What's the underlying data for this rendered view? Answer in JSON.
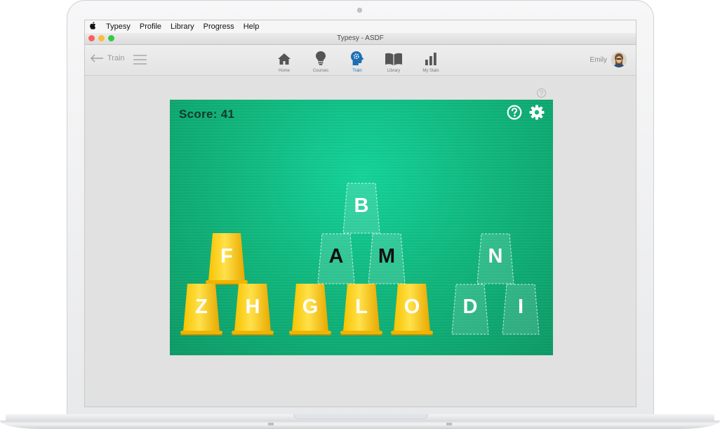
{
  "menubar": {
    "apple_icon": "apple-icon",
    "items": [
      "Typesy",
      "Profile",
      "Library",
      "Progress",
      "Help"
    ]
  },
  "window": {
    "title": "Typesy - ASDF",
    "traffic_lights": [
      "#fc605c",
      "#fdbc40",
      "#34c84a"
    ]
  },
  "toolbar": {
    "back_label": "Train",
    "nav": [
      {
        "label": "Home",
        "icon": "home-icon",
        "active": false
      },
      {
        "label": "Courses",
        "icon": "lightbulb-icon",
        "active": false
      },
      {
        "label": "Train",
        "icon": "brain-head-icon",
        "active": true
      },
      {
        "label": "Library",
        "icon": "book-icon",
        "active": false
      },
      {
        "label": "My Stats",
        "icon": "bar-chart-icon",
        "active": false
      }
    ],
    "user_name": "Emily",
    "active_color": "#1c6fb4"
  },
  "game": {
    "score_label": "Score:",
    "score_value": "41",
    "background": "#10b87e",
    "cup_color": "#f6b800",
    "cups": [
      {
        "letter": "F",
        "state": "stacked"
      },
      {
        "letter": "Z",
        "state": "stacked"
      },
      {
        "letter": "H",
        "state": "stacked"
      },
      {
        "letter": "G",
        "state": "stacked"
      },
      {
        "letter": "L",
        "state": "stacked"
      },
      {
        "letter": "O",
        "state": "stacked"
      },
      {
        "letter": "B",
        "state": "pending"
      },
      {
        "letter": "A",
        "state": "target"
      },
      {
        "letter": "M",
        "state": "target"
      },
      {
        "letter": "N",
        "state": "pending"
      },
      {
        "letter": "D",
        "state": "pending"
      },
      {
        "letter": "I",
        "state": "pending"
      }
    ]
  }
}
